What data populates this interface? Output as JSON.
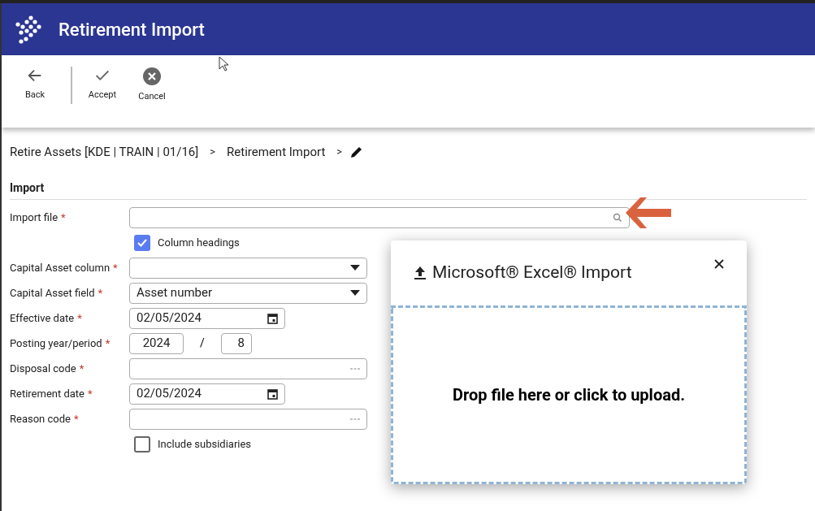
{
  "header": {
    "title": "Retirement Import"
  },
  "toolbar": [
    {
      "kind": "back",
      "label": "Back"
    },
    {
      "kind": "accept",
      "label": "Accept"
    },
    {
      "kind": "cancel",
      "label": "Cancel"
    }
  ],
  "breadcrumb": [
    {
      "label": "Retire Assets [KDE | TRAIN | 01/16]"
    },
    {
      "label": ">"
    },
    {
      "label": "Retirement Import"
    },
    {
      "label": ">"
    }
  ],
  "section": {
    "title": "Import"
  },
  "fields": [
    {
      "kind": "lookup",
      "label": "Import file",
      "required_mark": "*"
    },
    {
      "kind": "checkbox",
      "label": "Column headings",
      "checked": true
    },
    {
      "kind": "select",
      "label": "Capital Asset column",
      "required_mark": "*"
    },
    {
      "kind": "select",
      "label": "Capital Asset field",
      "required_mark": "*",
      "value": "Asset number"
    },
    {
      "kind": "date",
      "label": "Effective date",
      "required_mark": "*",
      "value": "02/05/2024"
    },
    {
      "kind": "period",
      "label": "Posting year/period",
      "required_mark": "*",
      "year": "2024",
      "separator": "/",
      "period": "8"
    },
    {
      "kind": "code",
      "label": "Disposal code",
      "required_mark": "*"
    },
    {
      "kind": "date",
      "label": "Retirement date",
      "required_mark": "*",
      "value": "02/05/2024"
    },
    {
      "kind": "code",
      "label": "Reason code",
      "required_mark": "*"
    },
    {
      "kind": "checkbox",
      "label": "Include subsidiaries",
      "checked": false
    }
  ],
  "dialog": {
    "title": "Microsoft® Excel® Import",
    "dropzone_text": "Drop file here or click to upload."
  }
}
